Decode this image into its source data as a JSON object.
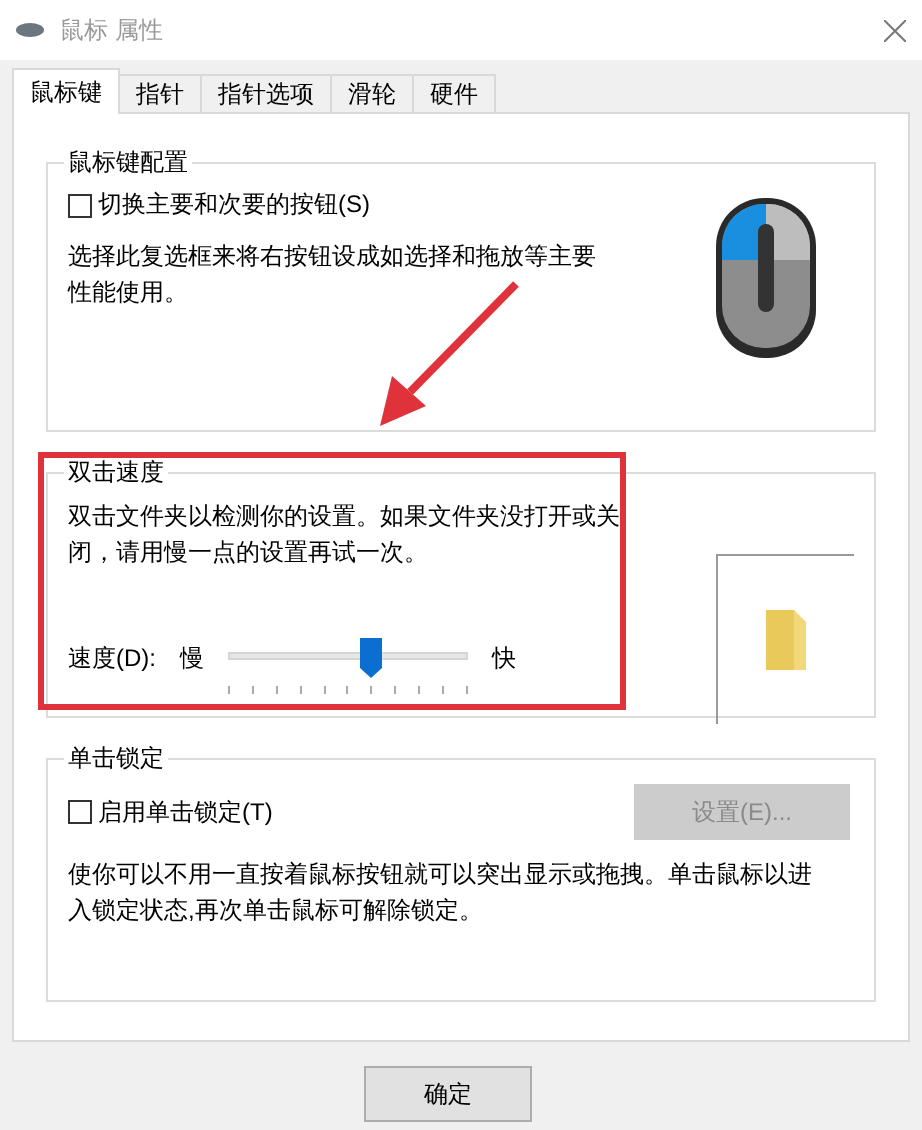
{
  "window": {
    "title": "鼠标 属性"
  },
  "tabs": [
    {
      "label": "鼠标键",
      "selected": true
    },
    {
      "label": "指针",
      "selected": false
    },
    {
      "label": "指针选项",
      "selected": false
    },
    {
      "label": "滑轮",
      "selected": false
    },
    {
      "label": "硬件",
      "selected": false
    }
  ],
  "button_config": {
    "title": "鼠标键配置",
    "checkbox": {
      "label": "切换主要和次要的按钮(S)",
      "checked": false
    },
    "description": "选择此复选框来将右按钮设成如选择和拖放等主要性能使用。"
  },
  "double_click": {
    "title": "双击速度",
    "description": "双击文件夹以检测你的设置。如果文件夹没打开或关闭，请用慢一点的设置再试一次。",
    "speed_label": "速度(D):",
    "slow_label": "慢",
    "fast_label": "快",
    "level": 0.59
  },
  "click_lock": {
    "title": "单击锁定",
    "checkbox": {
      "label": "启用单击锁定(T)",
      "checked": false
    },
    "settings_button": {
      "label": "设置(E)...",
      "disabled": true
    },
    "description": "使你可以不用一直按着鼠标按钮就可以突出显示或拖拽。单击鼠标以进入锁定状态,再次单击鼠标可解除锁定。"
  },
  "buttons": [
    {
      "label": "确定"
    }
  ]
}
